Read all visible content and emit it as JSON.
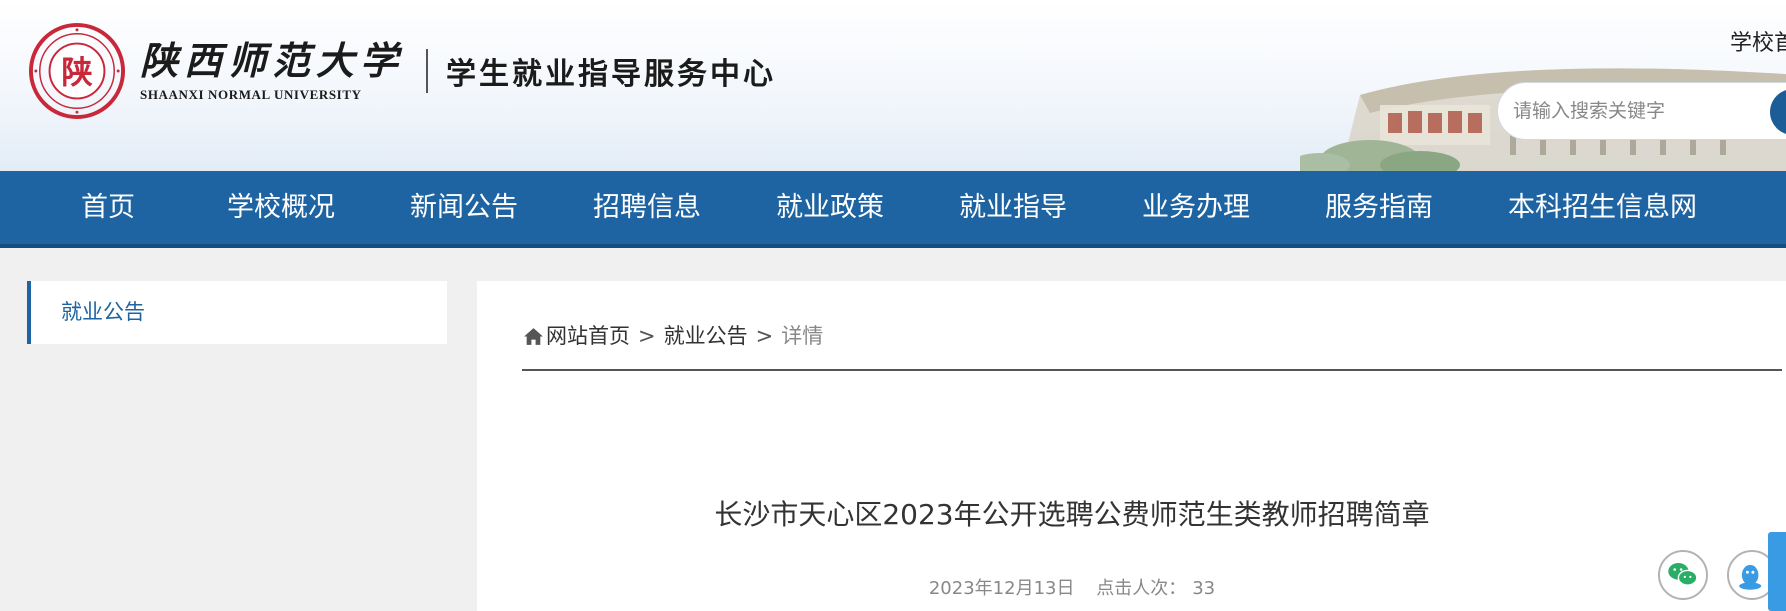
{
  "header": {
    "university_name_cn": "陕西师范大学",
    "university_name_en": "SHAANXI NORMAL UNIVERSITY",
    "center_name": "学生就业指导服务中心",
    "school_link": "学校首页",
    "search": {
      "placeholder": "请输入搜索关键字"
    }
  },
  "nav": {
    "items": [
      {
        "label": "首页"
      },
      {
        "label": "学校概况"
      },
      {
        "label": "新闻公告"
      },
      {
        "label": "招聘信息"
      },
      {
        "label": "就业政策"
      },
      {
        "label": "就业指导"
      },
      {
        "label": "业务办理"
      },
      {
        "label": "服务指南"
      },
      {
        "label": "本科招生信息网"
      }
    ]
  },
  "sidebar": {
    "items": [
      {
        "label": "就业公告"
      }
    ]
  },
  "breadcrumb": {
    "home": "网站首页",
    "separator": ">",
    "section": "就业公告",
    "current": "详情"
  },
  "article": {
    "title": "长沙市天心区2023年公开选聘公费师范生类教师招聘简章",
    "date": "2023年12月13日",
    "views_label": "点击人次：",
    "views": "33"
  },
  "floating": {
    "icons": [
      "wechat-icon",
      "qq-icon"
    ]
  },
  "colors": {
    "primary": "#1e63a2",
    "nav_bottom": "#164d80",
    "seal_red": "#c8283a",
    "float_tab": "#3a9be5",
    "wechat_green": "#2aae67"
  }
}
